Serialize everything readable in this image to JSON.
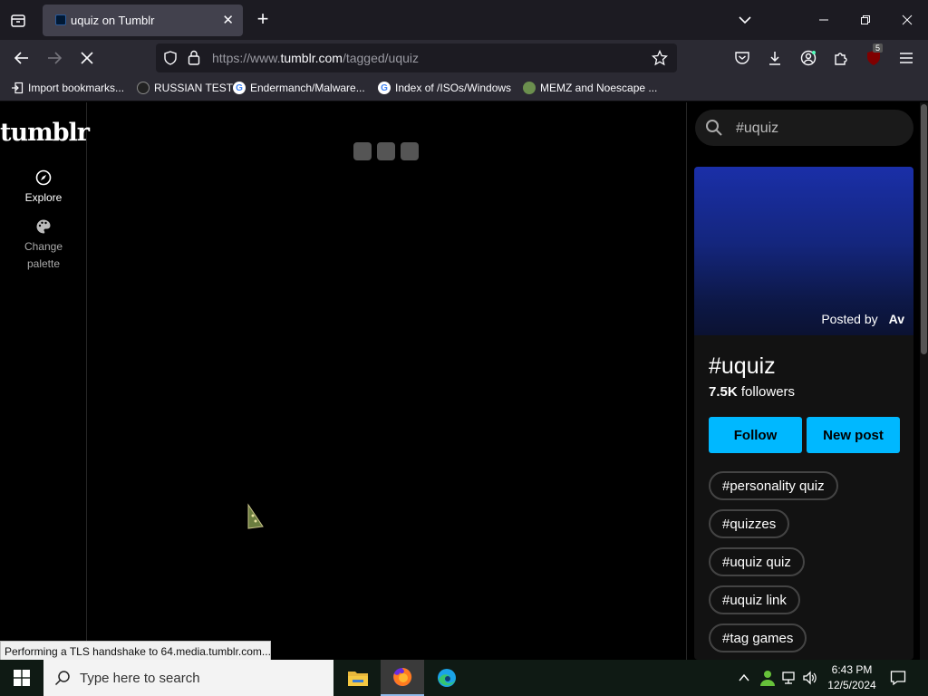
{
  "browser": {
    "tab_title": "uquiz on Tumblr",
    "tab_close": "✕",
    "new_tab": "+",
    "url_prefix": "https://www.",
    "url_host": "tumblr.com",
    "url_path": "/tagged/uquiz",
    "bookmarks": [
      {
        "label": "Import bookmarks..."
      },
      {
        "label": "RUSSIAN TEST"
      },
      {
        "label": "Endermanch/Malware..."
      },
      {
        "label": "Index of /ISOs/Windows"
      },
      {
        "label": "MEMZ and Noescape ..."
      }
    ],
    "extension_badge": "5"
  },
  "sidebar": {
    "logo": "tumblr",
    "explore_label": "Explore",
    "palette_label_1": "Change",
    "palette_label_2": "palette"
  },
  "right_panel": {
    "search_value": "#uquiz",
    "posted_by_label": "Posted by",
    "posted_by_avatar": "Av",
    "tag_title": "#uquiz",
    "followers_count": "7.5K",
    "followers_label": "followers",
    "follow_label": "Follow",
    "new_post_label": "New post",
    "related_tags": [
      "#personality quiz",
      "#quizzes",
      "#uquiz quiz",
      "#uquiz link",
      "#tag games"
    ]
  },
  "status_text": "Performing a TLS handshake to 64.media.tumblr.com...",
  "taskbar": {
    "search_placeholder": "Type here to search",
    "time": "6:43 PM",
    "date": "12/5/2024"
  },
  "colors": {
    "accent": "#00b8ff",
    "tab_bg": "#42414d",
    "toolbar_bg": "#2b2a33"
  }
}
